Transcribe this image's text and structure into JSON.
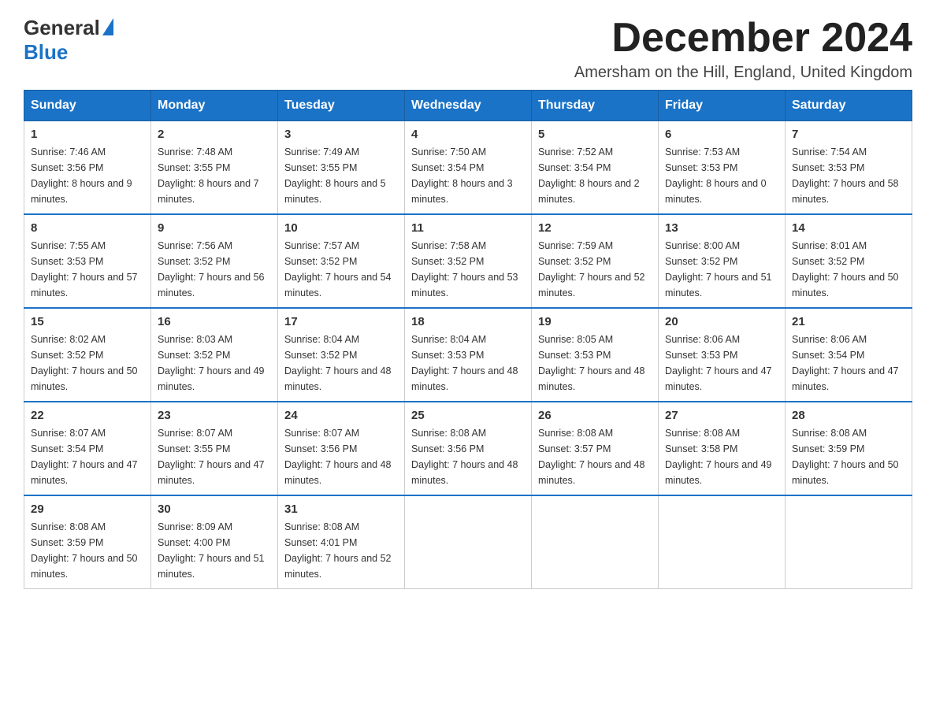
{
  "header": {
    "logo_general": "General",
    "logo_blue": "Blue",
    "month_title": "December 2024",
    "location": "Amersham on the Hill, England, United Kingdom"
  },
  "days_of_week": [
    "Sunday",
    "Monday",
    "Tuesday",
    "Wednesday",
    "Thursday",
    "Friday",
    "Saturday"
  ],
  "weeks": [
    [
      {
        "day": "1",
        "sunrise": "7:46 AM",
        "sunset": "3:56 PM",
        "daylight": "8 hours and 9 minutes."
      },
      {
        "day": "2",
        "sunrise": "7:48 AM",
        "sunset": "3:55 PM",
        "daylight": "8 hours and 7 minutes."
      },
      {
        "day": "3",
        "sunrise": "7:49 AM",
        "sunset": "3:55 PM",
        "daylight": "8 hours and 5 minutes."
      },
      {
        "day": "4",
        "sunrise": "7:50 AM",
        "sunset": "3:54 PM",
        "daylight": "8 hours and 3 minutes."
      },
      {
        "day": "5",
        "sunrise": "7:52 AM",
        "sunset": "3:54 PM",
        "daylight": "8 hours and 2 minutes."
      },
      {
        "day": "6",
        "sunrise": "7:53 AM",
        "sunset": "3:53 PM",
        "daylight": "8 hours and 0 minutes."
      },
      {
        "day": "7",
        "sunrise": "7:54 AM",
        "sunset": "3:53 PM",
        "daylight": "7 hours and 58 minutes."
      }
    ],
    [
      {
        "day": "8",
        "sunrise": "7:55 AM",
        "sunset": "3:53 PM",
        "daylight": "7 hours and 57 minutes."
      },
      {
        "day": "9",
        "sunrise": "7:56 AM",
        "sunset": "3:52 PM",
        "daylight": "7 hours and 56 minutes."
      },
      {
        "day": "10",
        "sunrise": "7:57 AM",
        "sunset": "3:52 PM",
        "daylight": "7 hours and 54 minutes."
      },
      {
        "day": "11",
        "sunrise": "7:58 AM",
        "sunset": "3:52 PM",
        "daylight": "7 hours and 53 minutes."
      },
      {
        "day": "12",
        "sunrise": "7:59 AM",
        "sunset": "3:52 PM",
        "daylight": "7 hours and 52 minutes."
      },
      {
        "day": "13",
        "sunrise": "8:00 AM",
        "sunset": "3:52 PM",
        "daylight": "7 hours and 51 minutes."
      },
      {
        "day": "14",
        "sunrise": "8:01 AM",
        "sunset": "3:52 PM",
        "daylight": "7 hours and 50 minutes."
      }
    ],
    [
      {
        "day": "15",
        "sunrise": "8:02 AM",
        "sunset": "3:52 PM",
        "daylight": "7 hours and 50 minutes."
      },
      {
        "day": "16",
        "sunrise": "8:03 AM",
        "sunset": "3:52 PM",
        "daylight": "7 hours and 49 minutes."
      },
      {
        "day": "17",
        "sunrise": "8:04 AM",
        "sunset": "3:52 PM",
        "daylight": "7 hours and 48 minutes."
      },
      {
        "day": "18",
        "sunrise": "8:04 AM",
        "sunset": "3:53 PM",
        "daylight": "7 hours and 48 minutes."
      },
      {
        "day": "19",
        "sunrise": "8:05 AM",
        "sunset": "3:53 PM",
        "daylight": "7 hours and 48 minutes."
      },
      {
        "day": "20",
        "sunrise": "8:06 AM",
        "sunset": "3:53 PM",
        "daylight": "7 hours and 47 minutes."
      },
      {
        "day": "21",
        "sunrise": "8:06 AM",
        "sunset": "3:54 PM",
        "daylight": "7 hours and 47 minutes."
      }
    ],
    [
      {
        "day": "22",
        "sunrise": "8:07 AM",
        "sunset": "3:54 PM",
        "daylight": "7 hours and 47 minutes."
      },
      {
        "day": "23",
        "sunrise": "8:07 AM",
        "sunset": "3:55 PM",
        "daylight": "7 hours and 47 minutes."
      },
      {
        "day": "24",
        "sunrise": "8:07 AM",
        "sunset": "3:56 PM",
        "daylight": "7 hours and 48 minutes."
      },
      {
        "day": "25",
        "sunrise": "8:08 AM",
        "sunset": "3:56 PM",
        "daylight": "7 hours and 48 minutes."
      },
      {
        "day": "26",
        "sunrise": "8:08 AM",
        "sunset": "3:57 PM",
        "daylight": "7 hours and 48 minutes."
      },
      {
        "day": "27",
        "sunrise": "8:08 AM",
        "sunset": "3:58 PM",
        "daylight": "7 hours and 49 minutes."
      },
      {
        "day": "28",
        "sunrise": "8:08 AM",
        "sunset": "3:59 PM",
        "daylight": "7 hours and 50 minutes."
      }
    ],
    [
      {
        "day": "29",
        "sunrise": "8:08 AM",
        "sunset": "3:59 PM",
        "daylight": "7 hours and 50 minutes."
      },
      {
        "day": "30",
        "sunrise": "8:09 AM",
        "sunset": "4:00 PM",
        "daylight": "7 hours and 51 minutes."
      },
      {
        "day": "31",
        "sunrise": "8:08 AM",
        "sunset": "4:01 PM",
        "daylight": "7 hours and 52 minutes."
      },
      null,
      null,
      null,
      null
    ]
  ]
}
